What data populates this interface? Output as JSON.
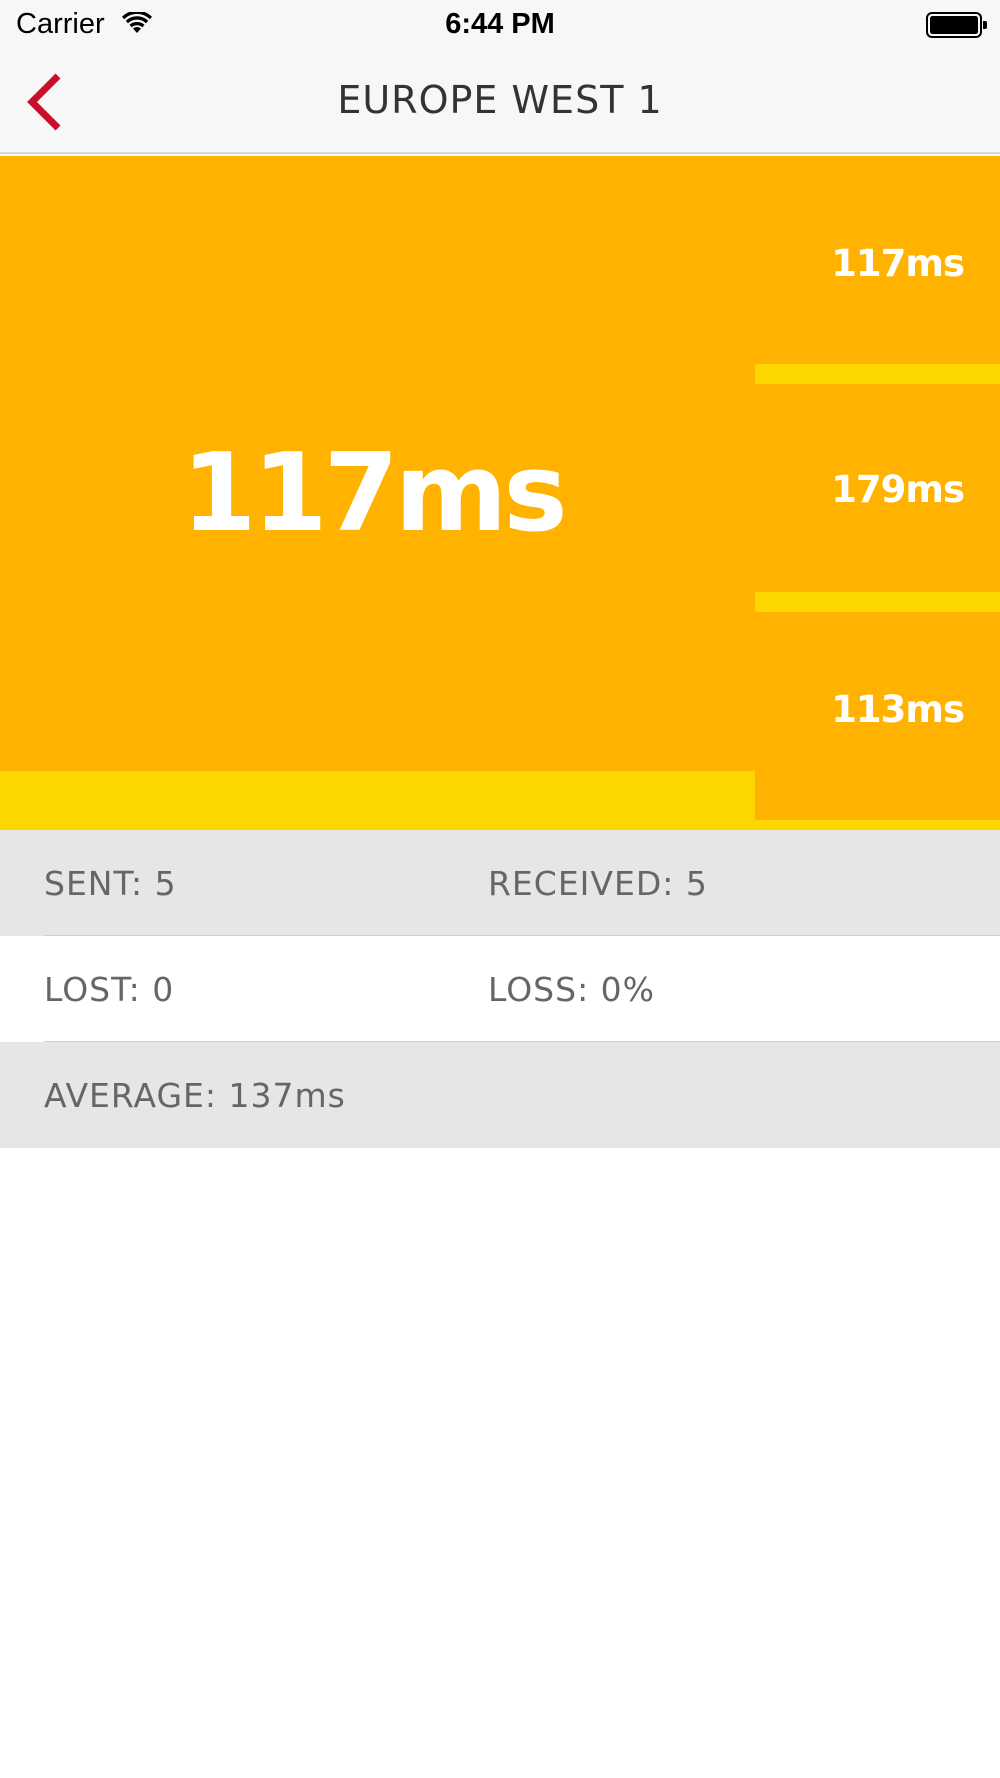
{
  "status_bar": {
    "carrier": "Carrier",
    "time": "6:44 PM",
    "wifi_icon": "wifi-icon",
    "battery_icon": "battery-full-icon"
  },
  "nav": {
    "title": "EUROPE WEST 1",
    "back_icon": "chevron-left-icon",
    "accent_color": "#c8102e"
  },
  "ping": {
    "current_label": "117ms",
    "current_fill_fraction": 0.087,
    "history": [
      {
        "label": "117ms",
        "fill_fraction": 0.087
      },
      {
        "label": "179ms",
        "fill_fraction": 0.087
      },
      {
        "label": "113ms",
        "fill_fraction": 0.087
      }
    ],
    "colors": {
      "background": "#ffb300",
      "fill": "#fdd600",
      "text": "#ffffff"
    }
  },
  "stats": {
    "sent": "SENT: 5",
    "received": "RECEIVED: 5",
    "lost": "LOST: 0",
    "loss": "LOSS: 0%",
    "average": "AVERAGE: 137ms"
  }
}
